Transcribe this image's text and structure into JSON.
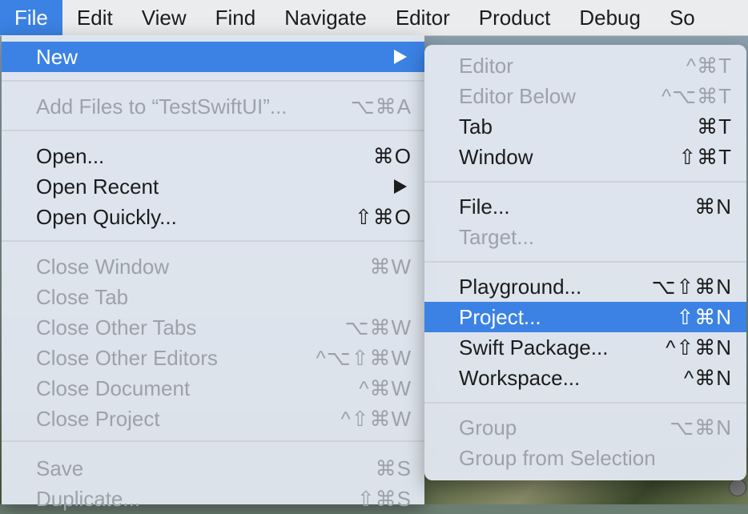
{
  "menubar": {
    "items": [
      "File",
      "Edit",
      "View",
      "Find",
      "Navigate",
      "Editor",
      "Product",
      "Debug",
      "So"
    ]
  },
  "file_menu": {
    "new": "New",
    "add_files": {
      "label": "Add Files to “TestSwiftUI”...",
      "shortcut": "⌥⌘A"
    },
    "open": {
      "label": "Open...",
      "shortcut": "⌘O"
    },
    "open_recent": {
      "label": "Open Recent"
    },
    "open_quickly": {
      "label": "Open Quickly...",
      "shortcut": "⇧⌘O"
    },
    "close_window": {
      "label": "Close Window",
      "shortcut": "⌘W"
    },
    "close_tab": {
      "label": "Close Tab"
    },
    "close_other_tabs": {
      "label": "Close Other Tabs",
      "shortcut": "⌥⌘W"
    },
    "close_other_editors": {
      "label": "Close Other Editors",
      "shortcut": "^⌥⇧⌘W"
    },
    "close_document": {
      "label": "Close Document",
      "shortcut": "^⌘W"
    },
    "close_project": {
      "label": "Close Project",
      "shortcut": "^⇧⌘W"
    },
    "save": {
      "label": "Save",
      "shortcut": "⌘S"
    },
    "duplicate": {
      "label": "Duplicate...",
      "shortcut": "⇧⌘S"
    }
  },
  "new_submenu": {
    "editor": {
      "label": "Editor",
      "shortcut": "^⌘T"
    },
    "editor_below": {
      "label": "Editor Below",
      "shortcut": "^⌥⌘T"
    },
    "tab": {
      "label": "Tab",
      "shortcut": "⌘T"
    },
    "window": {
      "label": "Window",
      "shortcut": "⇧⌘T"
    },
    "file": {
      "label": "File...",
      "shortcut": "⌘N"
    },
    "target": {
      "label": "Target..."
    },
    "playground": {
      "label": "Playground...",
      "shortcut": "⌥⇧⌘N"
    },
    "project": {
      "label": "Project...",
      "shortcut": "⇧⌘N"
    },
    "swift_package": {
      "label": "Swift Package...",
      "shortcut": "^⇧⌘N"
    },
    "workspace": {
      "label": "Workspace...",
      "shortcut": "^⌘N"
    },
    "group": {
      "label": "Group",
      "shortcut": "⌥⌘N"
    },
    "group_from_selection": {
      "label": "Group from Selection"
    }
  },
  "colors": {
    "accent": "#3b82e4",
    "disabled_text": "#9da2aa",
    "menu_bg": "#e1e7f0"
  }
}
